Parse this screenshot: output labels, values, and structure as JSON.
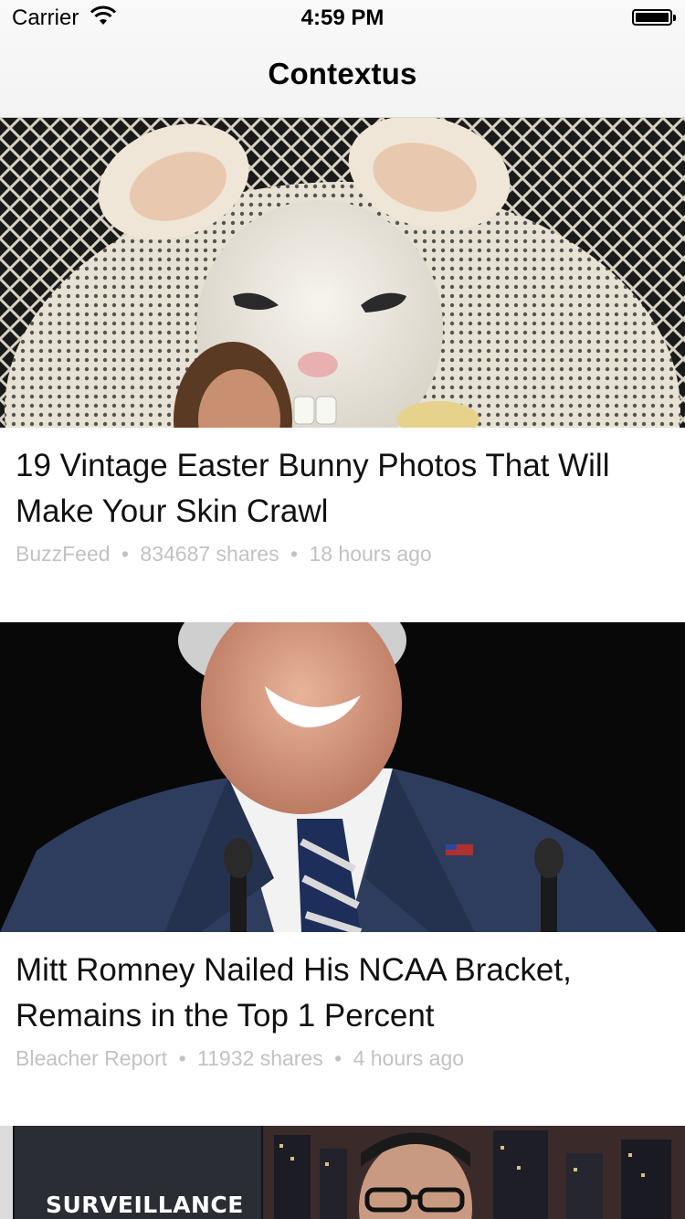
{
  "status_bar": {
    "carrier": "Carrier",
    "time": "4:59 PM",
    "wifi_icon": "wifi-icon",
    "battery_icon": "battery-icon"
  },
  "nav": {
    "title": "Contextus"
  },
  "articles": [
    {
      "headline": "19 Vintage Easter Bunny Photos That Will Make Your Skin Crawl",
      "source": "BuzzFeed",
      "shares": "834687 shares",
      "age": "18 hours ago",
      "image": "creepy-easter-bunny-photo"
    },
    {
      "headline": "Mitt Romney Nailed His NCAA Bracket, Remains in the Top 1 Percent",
      "source": "Bleacher Report",
      "shares": "11932 shares",
      "age": "4 hours ago",
      "image": "mitt-romney-photo"
    },
    {
      "image_label": "SURVEILLANCE",
      "image": "surveillance-segment-photo"
    }
  ],
  "separator": "•",
  "colors": {
    "meta_text": "#c2c2c2",
    "nav_background": "#f7f7f7"
  }
}
